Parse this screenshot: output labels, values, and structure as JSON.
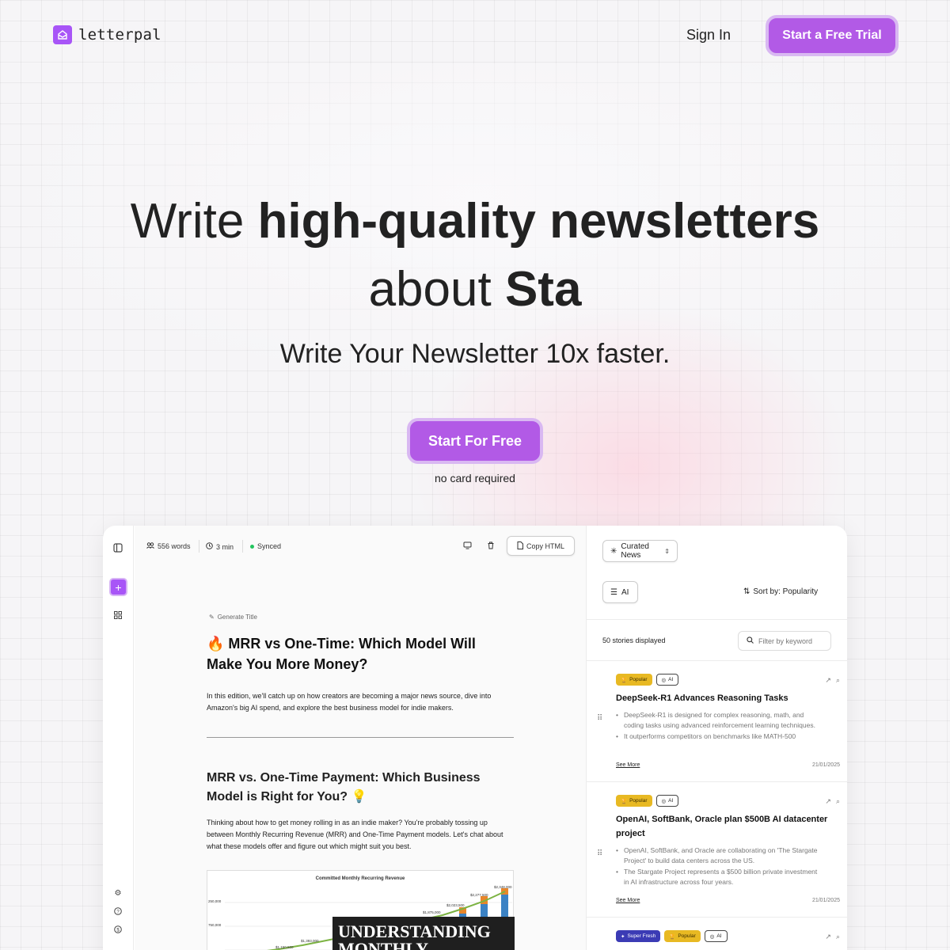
{
  "nav": {
    "logo_text": "letterpal",
    "sign_in": "Sign In",
    "trial_button": "Start a Free Trial"
  },
  "hero": {
    "line1_normal": "Write ",
    "line1_bold": "high-quality newsletters",
    "line2_normal": "about ",
    "line2_bold": "Sta",
    "subtitle": "Write Your Newsletter 10x faster.",
    "cta": "Start For Free",
    "cta_note": "no card required"
  },
  "editor": {
    "words": "556 words",
    "read_time": "3 min",
    "sync_status": "Synced",
    "copy_html": "Copy HTML",
    "generate_title": "Generate Title",
    "title": "🔥 MRR vs One-Time: Which Model Will Make You More Money?",
    "intro": "In this edition, we'll catch up on how creators are becoming a major news source, dive into Amazon's big AI spend, and explore the best business model for indie makers.",
    "section_title": "MRR vs. One-Time Payment: Which Business Model is Right for You? 💡",
    "section_body": "Thinking about how to get money rolling in as an indie maker? You're probably tossing up between Monthly Recurring Revenue (MRR) and One-Time Payment models. Let's chat about what these models offer and figure out which might suit you best.",
    "chart_title": "Committed Monthly Recurring Revenue",
    "chart_banner": "UNDERSTANDING MONTHLY",
    "chart_labels": [
      "$2,348,000",
      "$2,277,500",
      "$2,023,500",
      "$1,875,000",
      "$1,393,000",
      "$1,150,500"
    ],
    "chart_axis": [
      "250,000",
      "750,000"
    ]
  },
  "panel": {
    "source": "Curated News",
    "topic": "AI",
    "sort": "Sort by: Popularity",
    "stories_count": "50 stories displayed",
    "filter_placeholder": "Filter by keyword",
    "see_more": "See More",
    "cards": [
      {
        "badges": [
          "Popular",
          "AI"
        ],
        "title": "DeepSeek-R1 Advances Reasoning Tasks",
        "bullets": [
          "DeepSeek-R1 is designed for complex reasoning, math, and coding tasks using advanced reinforcement learning techniques.",
          "It outperforms competitors on benchmarks like MATH-500"
        ],
        "date": "21/01/2025"
      },
      {
        "badges": [
          "Popular",
          "AI"
        ],
        "title": "OpenAI, SoftBank, Oracle plan $500B AI datacenter project",
        "bullets": [
          "OpenAI, SoftBank, and Oracle are collaborating on 'The Stargate Project' to build data centers across the US.",
          "The Stargate Project represents a $500 billion private investment in AI infrastructure across four years."
        ],
        "date": "21/01/2025"
      },
      {
        "badges": [
          "Super Fresh",
          "Popular",
          "AI"
        ]
      }
    ]
  },
  "colors": {
    "accent": "#b25ae6",
    "popular_badge": "#e8b923",
    "fresh_badge": "#3b3bb5",
    "synced": "#22c55e"
  }
}
